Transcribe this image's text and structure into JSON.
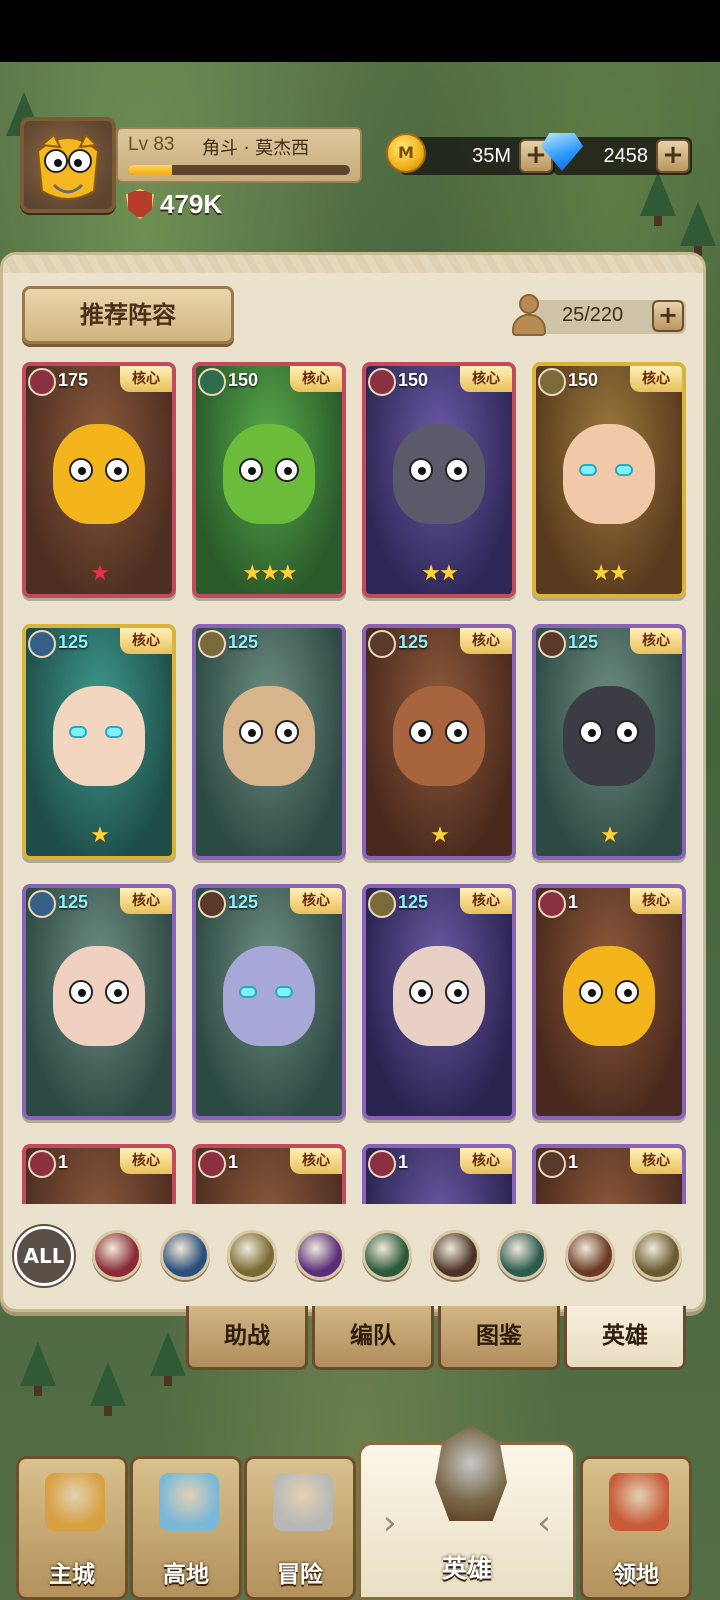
{
  "player": {
    "level_label": "Lv 83",
    "name": "角斗 · 莫杰西",
    "xp_progress": 0.2,
    "power": "479K",
    "avatar_icon": "yellow-monster-avatar"
  },
  "currency": {
    "gold": {
      "value": "35M",
      "icon": "gold-coin-icon",
      "coin_mark": "M",
      "add_label": "+"
    },
    "gems": {
      "value": "2458",
      "icon": "blue-diamond-icon",
      "add_label": "+"
    }
  },
  "panel": {
    "recommend_label": "推荐阵容",
    "hero_count": "25/220",
    "count_add_label": "+"
  },
  "heroes": [
    {
      "level": "175",
      "core": "核心",
      "class": "shield",
      "frame": "red",
      "stars": "★",
      "star_color": "red",
      "name_icon": "yellow-monster"
    },
    {
      "level": "150",
      "core": "核心",
      "class": "swords",
      "frame": "red",
      "stars": "★★★",
      "star_color": "gold",
      "name_icon": "green-orc"
    },
    {
      "level": "150",
      "core": "核心",
      "class": "shield",
      "frame": "red",
      "stars": "★★",
      "star_color": "gold",
      "name_icon": "horned-knight"
    },
    {
      "level": "150",
      "core": "核心",
      "class": "axe",
      "frame": "gold",
      "stars": "★★",
      "star_color": "gold",
      "name_icon": "elf-girl"
    },
    {
      "level": "125",
      "core": "核心",
      "class": "healer",
      "frame": "gold",
      "stars": "★",
      "star_color": "gold",
      "name_icon": "blonde-elf"
    },
    {
      "level": "125",
      "core": "",
      "class": "axe",
      "frame": "purple",
      "stars": "",
      "star_color": "gold",
      "name_icon": "mustache-warrior"
    },
    {
      "level": "125",
      "core": "核心",
      "class": "beast",
      "frame": "purple",
      "stars": "★",
      "star_color": "gold",
      "name_icon": "monkey-king"
    },
    {
      "level": "125",
      "core": "核心",
      "class": "beast",
      "frame": "purple",
      "stars": "★",
      "star_color": "gold",
      "name_icon": "dark-blob"
    },
    {
      "level": "125",
      "core": "核心",
      "class": "healer",
      "frame": "purple",
      "stars": "",
      "star_color": "gold",
      "name_icon": "dark-haired-girl"
    },
    {
      "level": "125",
      "core": "核心",
      "class": "beast",
      "frame": "purple",
      "stars": "",
      "star_color": "gold",
      "name_icon": "horned-elf"
    },
    {
      "level": "125",
      "core": "核心",
      "class": "axe",
      "frame": "purple",
      "stars": "",
      "star_color": "gold",
      "name_icon": "silver-hair-girl"
    },
    {
      "level": "1",
      "core": "核心",
      "class": "shield",
      "frame": "purple",
      "stars": "",
      "star_color": "gold",
      "name_icon": "yellow-monster"
    },
    {
      "level": "1",
      "core": "核心",
      "class": "shield",
      "frame": "red",
      "stars": "",
      "star_color": "gold",
      "name_icon": "yellow-monster"
    },
    {
      "level": "1",
      "core": "核心",
      "class": "shield",
      "frame": "red",
      "stars": "",
      "star_color": "gold",
      "name_icon": "yellow-monster"
    },
    {
      "level": "1",
      "core": "核心",
      "class": "shield",
      "frame": "purple",
      "stars": "",
      "star_color": "gold",
      "name_icon": "horned-knight"
    },
    {
      "level": "1",
      "core": "核心",
      "class": "beast",
      "frame": "purple",
      "stars": "",
      "star_color": "gold",
      "name_icon": "monkey-king"
    }
  ],
  "filters": {
    "all_label": "ALL",
    "icons": [
      {
        "icon": "shield-icon",
        "color": "#8a2a35"
      },
      {
        "icon": "staff-icon",
        "color": "#2a4f7a"
      },
      {
        "icon": "wings-icon",
        "color": "#7a6a30"
      },
      {
        "icon": "skull-icon",
        "color": "#5a2d7a"
      },
      {
        "icon": "crossed-swords-icon",
        "color": "#2a5a3a"
      },
      {
        "icon": "paw-icon",
        "color": "#4a3326"
      },
      {
        "icon": "bow-icon",
        "color": "#2a5a50"
      },
      {
        "icon": "bull-icon",
        "color": "#6a3a24"
      },
      {
        "icon": "axe-icon",
        "color": "#6a5a30"
      }
    ]
  },
  "subtabs": [
    {
      "label": "助战",
      "active": false
    },
    {
      "label": "编队",
      "active": false
    },
    {
      "label": "图鉴",
      "active": false
    },
    {
      "label": "英雄",
      "active": true
    }
  ],
  "nav": {
    "items": [
      {
        "label": "主城",
        "icon": "castle-icon",
        "color": "#d8a040"
      },
      {
        "label": "高地",
        "icon": "portal-icon",
        "color": "#7ab8d8"
      },
      {
        "label": "冒险",
        "icon": "crossed-swords-icon",
        "color": "#b8b8b8"
      }
    ],
    "active": {
      "label": "英雄",
      "icon": "helmet-icon",
      "left_arrow": "›",
      "right_arrow": "‹"
    },
    "last": {
      "label": "领地",
      "icon": "banner-icon",
      "color": "#c85a3a"
    }
  }
}
